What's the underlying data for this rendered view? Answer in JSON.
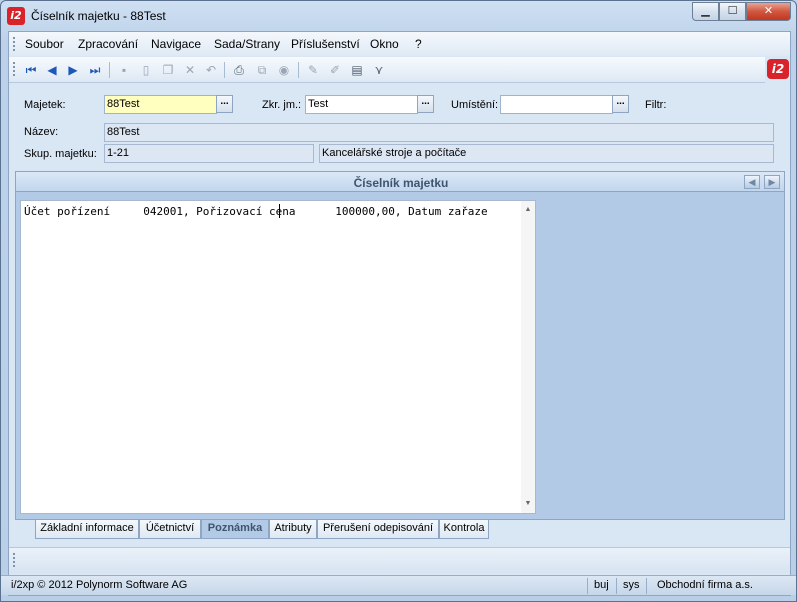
{
  "window": {
    "title": "Číselník majetku - 88Test",
    "app_icon": "i2-logo-icon",
    "buttons": {
      "minimize": "▁",
      "maximize": "☐",
      "close": "✕"
    }
  },
  "menu": [
    "Soubor",
    "Zpracování",
    "Navigace",
    "Sada/Strany",
    "Příslušenství",
    "Okno",
    "?"
  ],
  "toolbar": {
    "icons": [
      "first-record-icon",
      "previous-record-icon",
      "next-record-icon",
      "last-record-icon",
      "save-icon",
      "new-icon",
      "copy-icon",
      "delete-icon",
      "undo-icon",
      "print-icon",
      "tree-icon",
      "stop-icon",
      "edit-icon",
      "edit-alt-icon",
      "export-icon",
      "filter-icon"
    ],
    "glyphs": {
      "first": "⏮",
      "prev": "◀",
      "next": "▶",
      "last": "⏭",
      "save": "▪",
      "new": "▯",
      "copy": "❐",
      "delete": "✕",
      "undo": "↶",
      "print": "⎙",
      "tree": "⧉",
      "stop": "◉",
      "edit": "✎",
      "edit2": "✐",
      "export": "▤",
      "filter": "⋎"
    },
    "brand": "i2"
  },
  "form": {
    "majetek_label": "Majetek:",
    "majetek_value": "88Test",
    "zkr_label": "Zkr. jm.:",
    "zkr_value": "Test",
    "umisteni_label": "Umístění:",
    "umisteni_value": "",
    "filtr_label": "Filtr:",
    "nazev_label": "Název:",
    "nazev_value": "88Test",
    "skup_label": "Skup. majetku:",
    "skup_code": "1-21",
    "skup_name": "Kancelářské stroje a počítače",
    "lookup_button": "..."
  },
  "panel": {
    "title": "Číselník majetku",
    "nav_prev": "◀",
    "nav_next": "▶",
    "note_text": "Účet pořízení     042001, Pořizovací cena      100000,00, Datum zařaze",
    "scroll_up": "▲",
    "scroll_down": "▼"
  },
  "tabs": [
    {
      "label": "Základní informace",
      "active": false
    },
    {
      "label": "Účetnictví",
      "active": false
    },
    {
      "label": "Poznámka",
      "active": true
    },
    {
      "label": "Atributy",
      "active": false
    },
    {
      "label": "Přerušení odepisování",
      "active": false
    },
    {
      "label": "Kontrola",
      "active": false
    }
  ],
  "status": {
    "copyright": "i/2xp © 2012 Polynorm Software AG",
    "user": "buj",
    "db": "sys",
    "company": "Obchodní firma a.s."
  }
}
